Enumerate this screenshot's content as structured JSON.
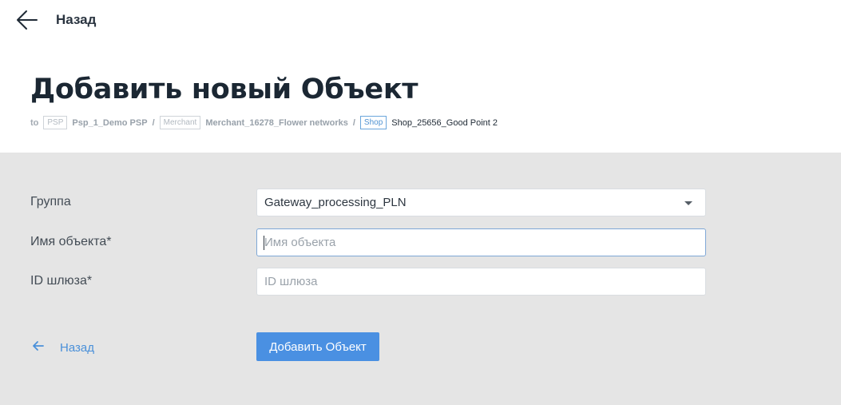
{
  "nav": {
    "back_label": "Назад"
  },
  "page": {
    "title": "Добавить новый Объект"
  },
  "breadcrumb": {
    "prefix": "to",
    "items": [
      {
        "badge": "PSP",
        "label": "Psp_1_Demo PSP"
      },
      {
        "badge": "Merchant",
        "label": "Merchant_16278_Flower networks"
      },
      {
        "badge": "Shop",
        "label": "Shop_25656_Good Point 2"
      }
    ],
    "separator": "/"
  },
  "form": {
    "group": {
      "label": "Группа",
      "value": "Gateway_processing_PLN"
    },
    "object_name": {
      "label": "Имя объекта*",
      "placeholder": "Имя объекта",
      "value": ""
    },
    "gateway_id": {
      "label": "ID шлюза*",
      "placeholder": "ID шлюза",
      "value": ""
    },
    "back_label": "Назад",
    "submit_label": "Добавить Объект"
  },
  "colors": {
    "accent": "#4a90e2",
    "form_background": "#e5e5e5",
    "title": "#1b2733"
  },
  "icons": {
    "back_top": "arrow-left-icon",
    "back_bottom": "arrow-left-icon",
    "dropdown": "chevron-down-icon"
  }
}
